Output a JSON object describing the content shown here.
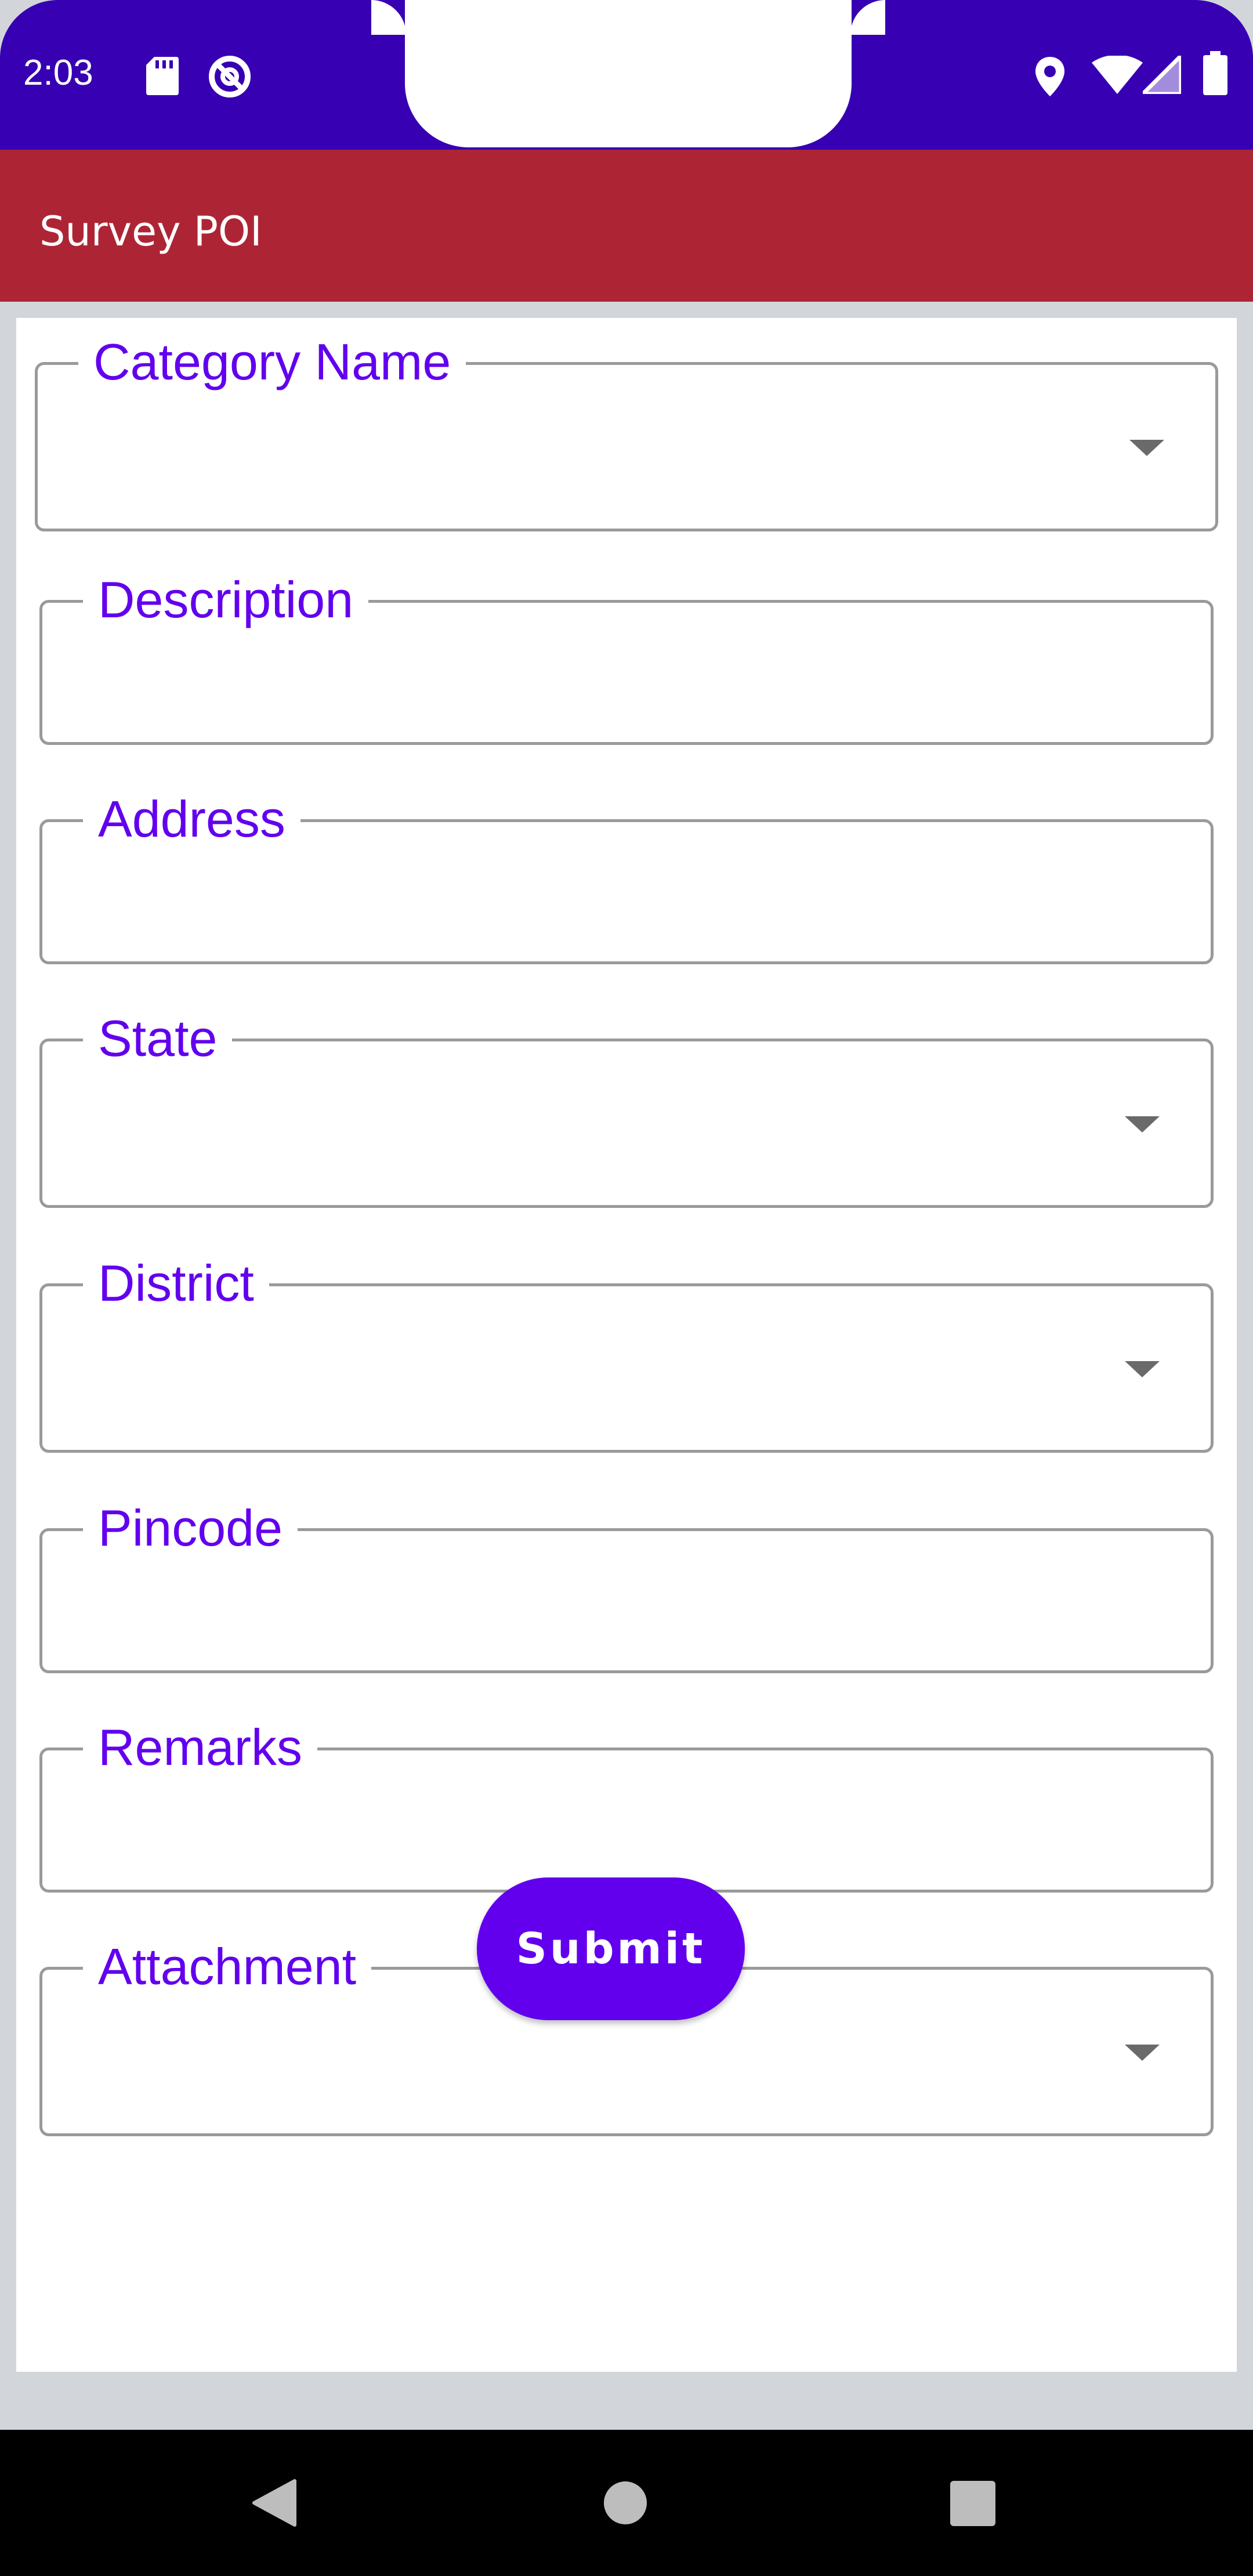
{
  "status_bar": {
    "time": "2:03",
    "icons": [
      "sd-card-icon",
      "do-not-disturb-icon",
      "location-icon",
      "wifi-icon",
      "cellular-signal-icon",
      "battery-icon"
    ],
    "color": "#3700b3"
  },
  "app_bar": {
    "title": "Survey POI",
    "color": "#ad2535"
  },
  "form": {
    "fields": [
      {
        "label": "Category Name",
        "type": "dropdown",
        "value": ""
      },
      {
        "label": "Description",
        "type": "text",
        "value": ""
      },
      {
        "label": "Address",
        "type": "text",
        "value": ""
      },
      {
        "label": "State",
        "type": "dropdown",
        "value": ""
      },
      {
        "label": "District",
        "type": "dropdown",
        "value": ""
      },
      {
        "label": "Pincode",
        "type": "text",
        "value": ""
      },
      {
        "label": "Remarks",
        "type": "text",
        "value": ""
      },
      {
        "label": "Attachment",
        "type": "dropdown",
        "value": ""
      }
    ],
    "label_color": "#6200ee",
    "submit_label": "Submit",
    "submit_color": "#6200ee"
  },
  "nav_bar": {
    "icons": [
      "back-icon",
      "home-icon",
      "recents-icon"
    ]
  }
}
